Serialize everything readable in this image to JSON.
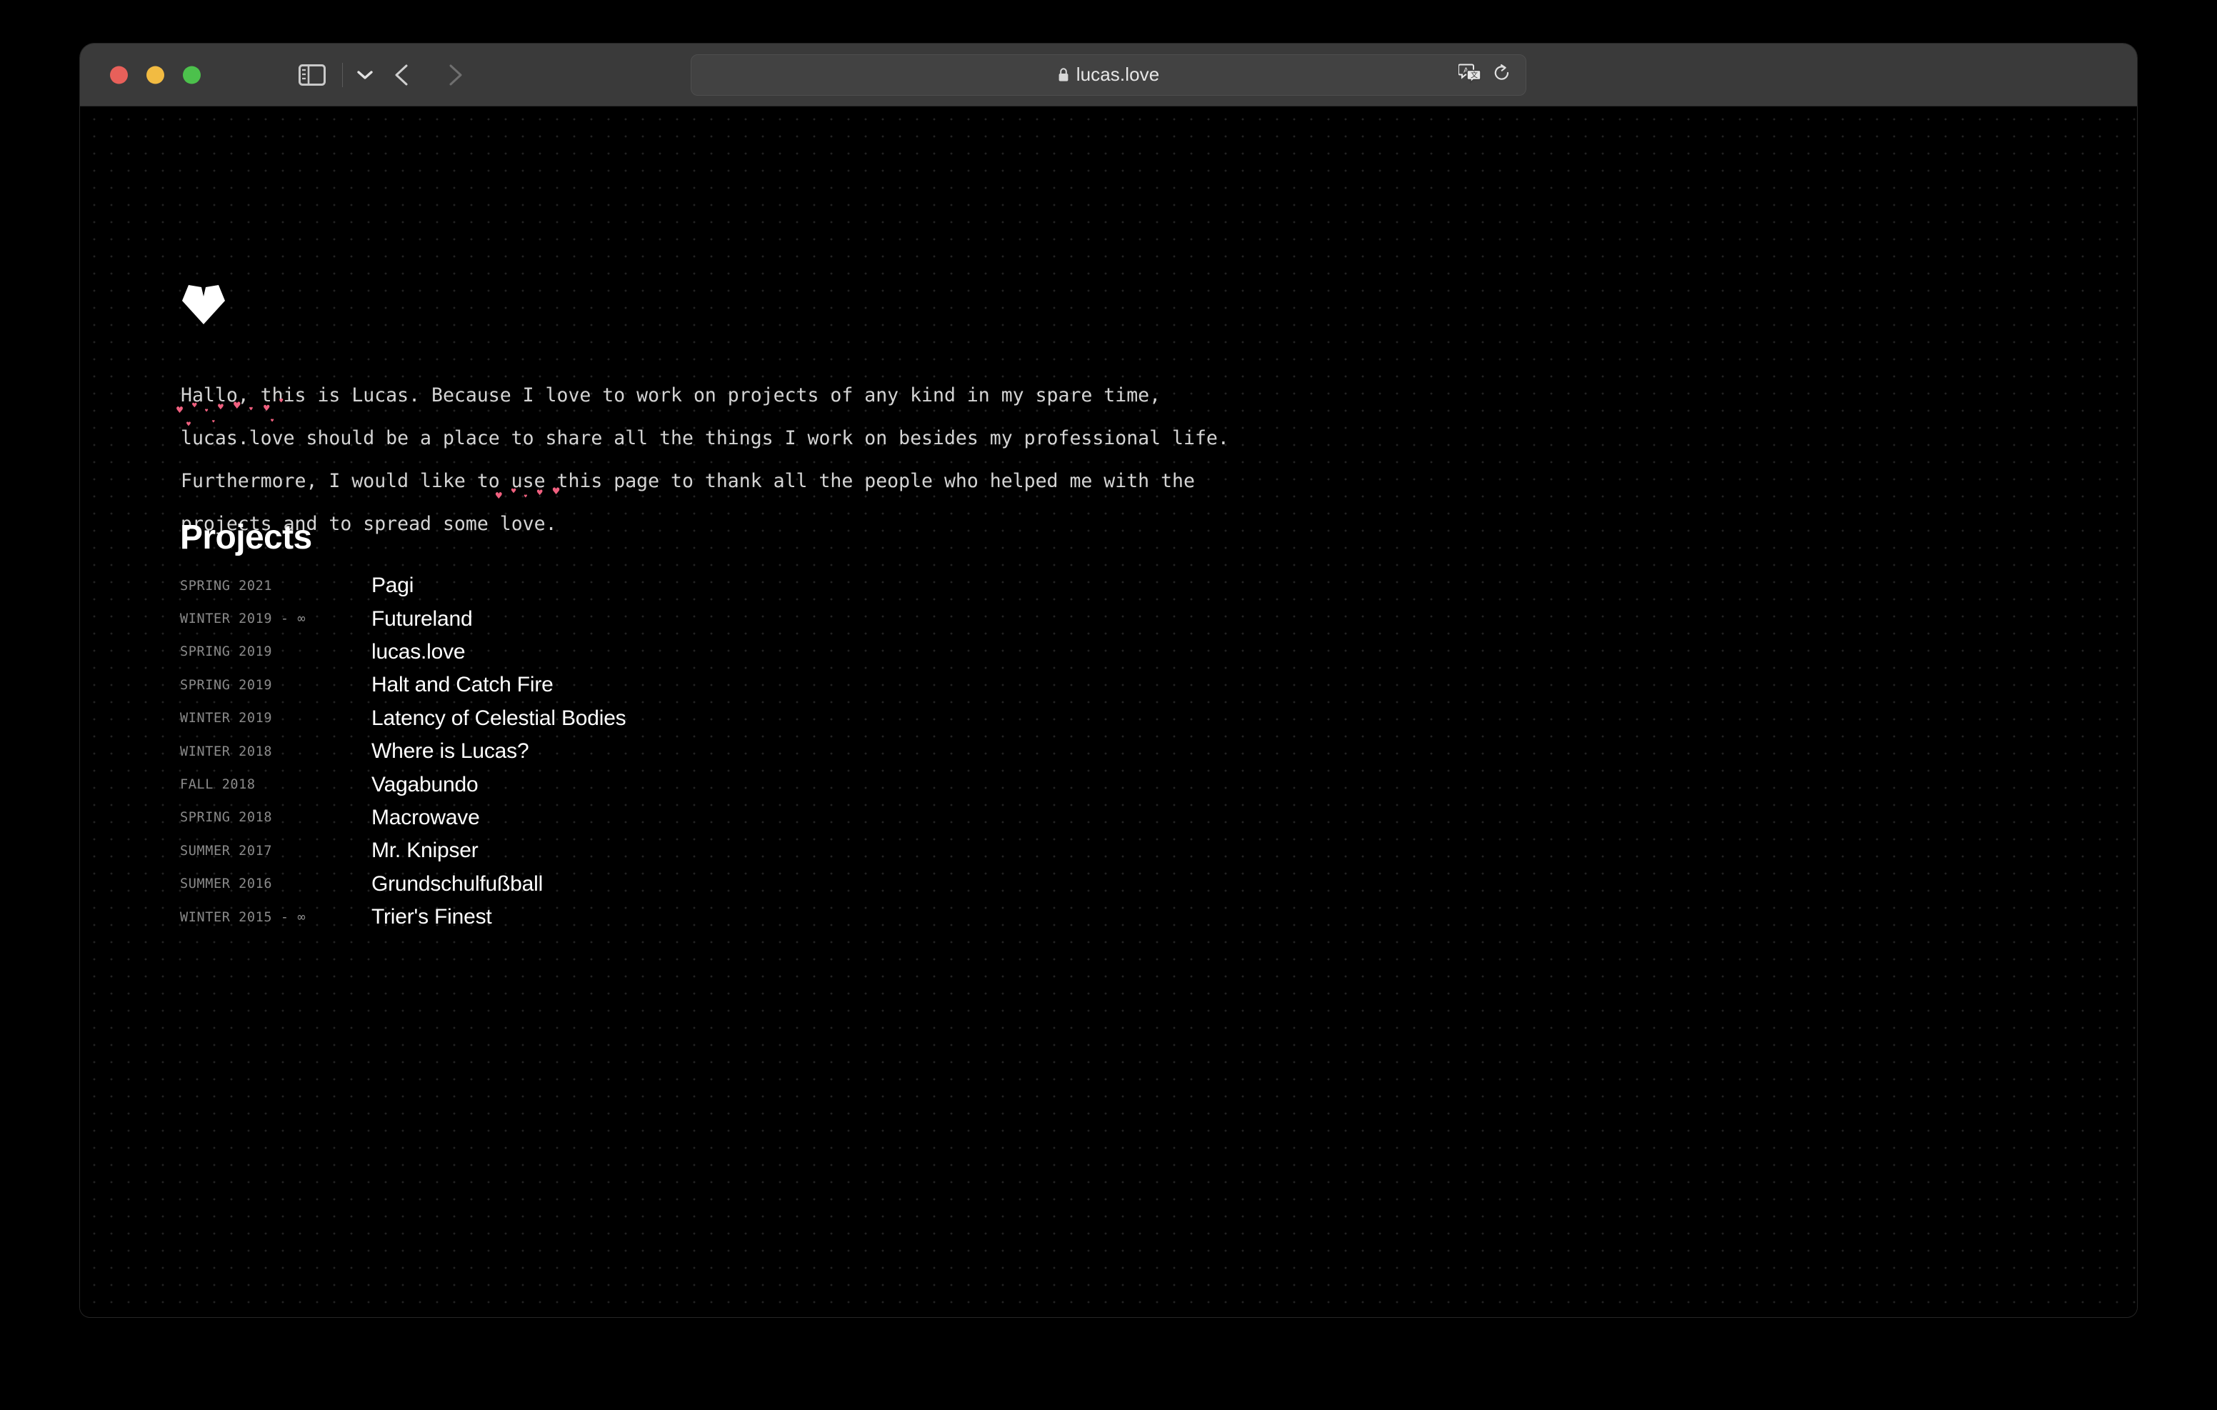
{
  "browser": {
    "traffic_lights": [
      "close",
      "minimize",
      "zoom"
    ],
    "colors": {
      "close": "#e8605a",
      "minimize": "#f2bb42",
      "zoom": "#4cc14c",
      "toolbar_bg": "#3a3a3a",
      "url_bg": "#424242",
      "page_bg": "#000000",
      "accent_pink": "#f0607f",
      "muted_text": "#8a8a8a"
    },
    "url": "lucas.love",
    "icons": {
      "sidebar": "sidebar-icon",
      "dropdown": "chevron-down-icon",
      "back": "chevron-left-icon",
      "forward": "chevron-right-icon",
      "lock": "lock-icon",
      "translate": "translate-icon",
      "reload": "reload-icon"
    }
  },
  "page": {
    "logo": "heart-logo",
    "intro_segments": [
      {
        "text": "Hallo, this is Lucas. Because I love to work on projects of any kind in my spare time, "
      },
      {
        "text": "lucas.love",
        "hearts": true
      },
      {
        "text": " should be a place to share all the things I work on besides my professional life. Furthermore, I would like to use this page to thank all the people who helped me with the projects and to spread some "
      },
      {
        "text": "love",
        "hearts": true
      },
      {
        "text": "."
      }
    ],
    "intro_text": "Hallo, this is Lucas. Because I love to work on projects of any kind in my spare time, lucas.love should be a place to share all the things I work on besides my professional life. Furthermore, I would like to use this page to thank all the people who helped me with the projects and to spread some love.",
    "projects_heading": "Projects",
    "projects": [
      {
        "date": "SPRING 2021",
        "name": "Pagi"
      },
      {
        "date": "WINTER 2019 - ∞",
        "name": "Futureland"
      },
      {
        "date": "SPRING 2019",
        "name": "lucas.love"
      },
      {
        "date": "SPRING 2019",
        "name": "Halt and Catch Fire"
      },
      {
        "date": "WINTER 2019",
        "name": "Latency of Celestial Bodies"
      },
      {
        "date": "WINTER 2018",
        "name": "Where is Lucas?"
      },
      {
        "date": "FALL 2018",
        "name": "Vagabundo"
      },
      {
        "date": "SPRING 2018",
        "name": "Macrowave"
      },
      {
        "date": "SUMMER 2017",
        "name": "Mr. Knipser"
      },
      {
        "date": "SUMMER 2016",
        "name": "Grundschulfußball"
      },
      {
        "date": "WINTER 2015 - ∞",
        "name": "Trier's Finest"
      }
    ]
  }
}
